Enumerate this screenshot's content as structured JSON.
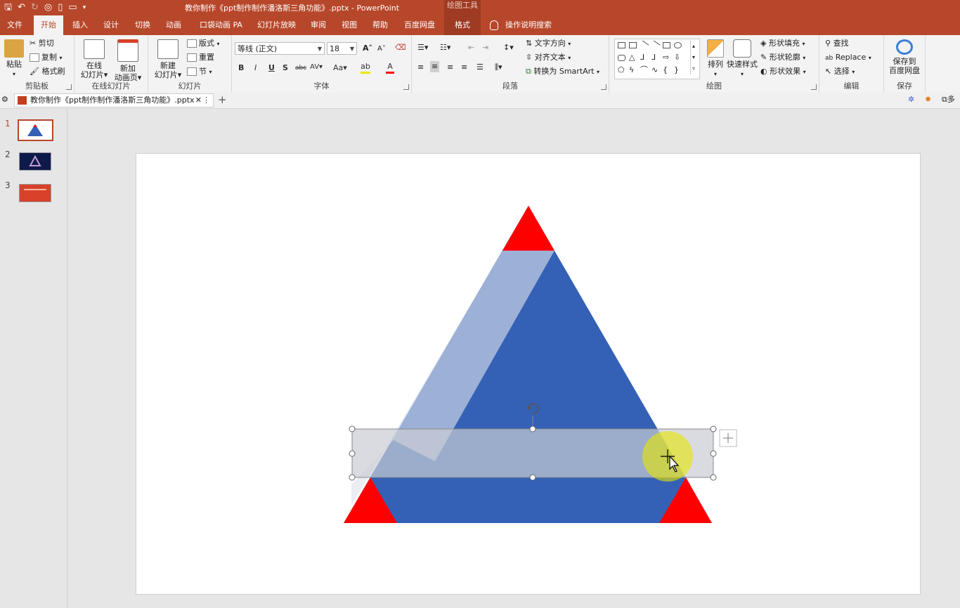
{
  "titlebar": {
    "doc_title": "教你制作《ppt制作制作潘洛斯三角功能》.pptx  -  PowerPoint",
    "drawing_tools": "绘图工具"
  },
  "tabs": {
    "file": "文件",
    "home": "开始",
    "insert": "插入",
    "design": "设计",
    "transitions": "切换",
    "animations": "动画",
    "pocket_animation": "口袋动画 PA",
    "slideshow": "幻灯片放映",
    "review": "审阅",
    "view": "视图",
    "help": "帮助",
    "baidu": "百度网盘",
    "format": "格式",
    "tell_me": "操作说明搜索"
  },
  "ribbon": {
    "clipboard": {
      "label": "剪贴板",
      "paste": "粘贴",
      "cut": "剪切",
      "copy": "复制",
      "format_painter": "格式刷"
    },
    "online": {
      "label": "在线幻灯片",
      "online_slide_1": "在线",
      "online_slide_2": "幻灯片",
      "new_anim_1": "新加",
      "new_anim_2": "动画页"
    },
    "slides": {
      "label": "幻灯片",
      "new_slide_1": "新建",
      "new_slide_2": "幻灯片",
      "layout": "版式",
      "reset": "重置",
      "section": "节"
    },
    "font": {
      "label": "字体",
      "font_name": "等线 (正文)",
      "font_size": "18",
      "bold": "B",
      "italic": "I",
      "underline": "U",
      "shadow": "S",
      "strike": "abc",
      "spacing": "AV",
      "case": "Aa",
      "grow": "A",
      "shrink": "A"
    },
    "paragraph": {
      "label": "段落",
      "text_direction": "文字方向",
      "align_text": "对齐文本",
      "smartart": "转换为 SmartArt"
    },
    "drawing": {
      "label": "绘图",
      "arrange": "排列",
      "quick_styles": "快速样式",
      "shape_fill": "形状填充",
      "shape_outline": "形状轮廓",
      "shape_effects": "形状效果"
    },
    "editing": {
      "label": "编辑",
      "find": "查找",
      "replace": "Replace",
      "select": "选择"
    },
    "save": {
      "label": "保存",
      "save_1": "保存到",
      "save_2": "百度网盘"
    }
  },
  "document_tab": {
    "name": "教你制作《ppt制作制作潘洛斯三角功能》.pptx"
  },
  "slides_pane": {
    "numbers": [
      "1",
      "2",
      "3"
    ]
  },
  "colors": {
    "accent": "#b7472a",
    "triangle_blue": "#3461b5",
    "red": "#ff0000",
    "band": "#a9b4cf"
  }
}
